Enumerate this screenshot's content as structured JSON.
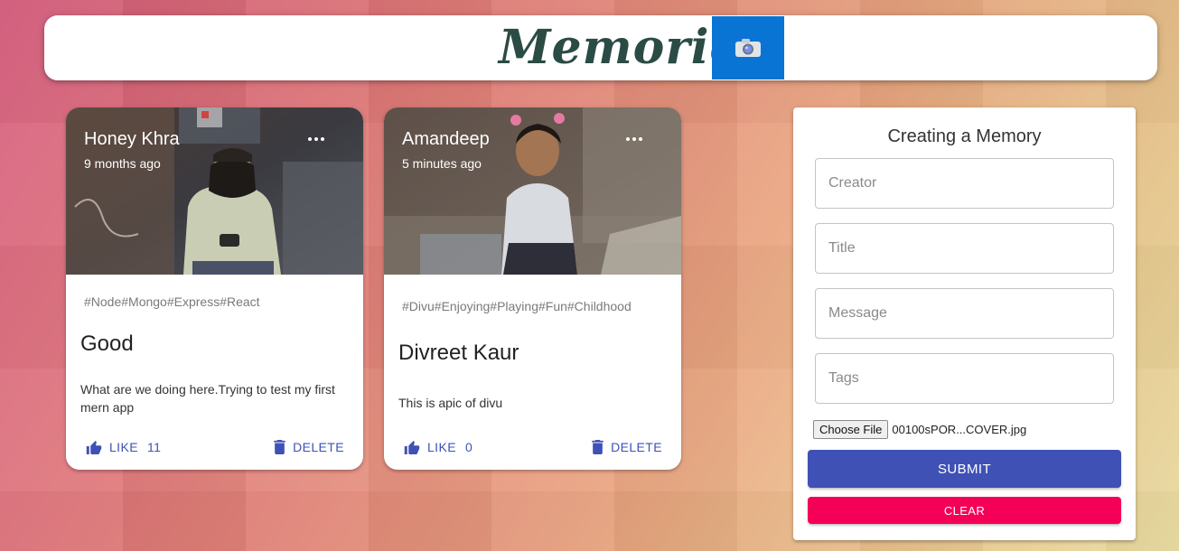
{
  "app": {
    "title": "Memories",
    "logo_icon": "camera-icon",
    "accent": "#0a74d4",
    "title_color": "#2b4b45"
  },
  "posts": [
    {
      "author": "Honey Khra",
      "time": "9 months ago",
      "tags": "#Node#Mongo#Express#React",
      "title": "Good",
      "message": "What are we doing here.Trying to test my first mern app",
      "like_label": "LIKE",
      "like_count": "11",
      "delete_label": "DELETE",
      "image_icon": "photo-of-man"
    },
    {
      "author": "Amandeep",
      "time": "5 minutes ago",
      "tags": "#Divu#Enjoying#Playing#Fun#Childhood",
      "title": "Divreet Kaur",
      "message": "This is apic of divu",
      "like_label": "LIKE",
      "like_count": "0",
      "delete_label": "DELETE",
      "image_icon": "photo-of-child"
    }
  ],
  "form": {
    "heading": "Creating a Memory",
    "creator_placeholder": "Creator",
    "title_placeholder": "Title",
    "message_placeholder": "Message",
    "tags_placeholder": "Tags",
    "file_button": "Choose File",
    "file_name": "00100sPOR...COVER.jpg",
    "submit_label": "SUBMIT",
    "clear_label": "CLEAR",
    "submit_color": "#3f51b5",
    "clear_color": "#f50057"
  }
}
